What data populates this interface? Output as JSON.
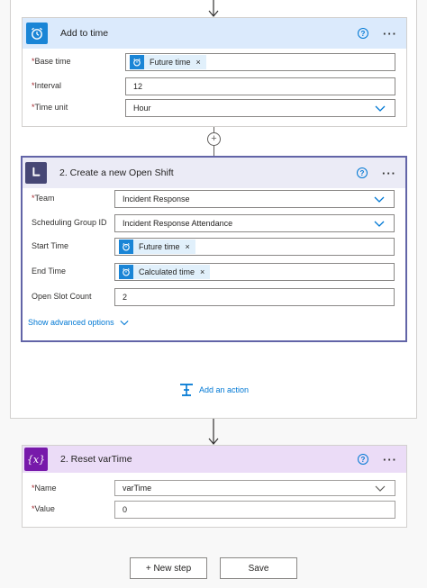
{
  "add_to_time": {
    "title": "Add to time",
    "header_color": "#dbeafc",
    "icon": "alarm-clock-icon",
    "fields": {
      "base_time_label": "Base time",
      "base_time_token": "Future time",
      "interval_label": "Interval",
      "interval_value": "12",
      "time_unit_label": "Time unit",
      "time_unit_value": "Hour"
    }
  },
  "open_shift": {
    "title": "2. Create a new Open Shift",
    "header_color": "#ebebf6",
    "icon": "teams-shifts-icon",
    "fields": {
      "team_label": "Team",
      "team_value": "Incident Response",
      "group_label": "Scheduling Group ID",
      "group_value": "Incident Response Attendance",
      "start_label": "Start Time",
      "start_token": "Future time",
      "end_label": "End Time",
      "end_token": "Calculated time",
      "slots_label": "Open Slot Count",
      "slots_value": "2"
    },
    "advanced_link": "Show advanced options"
  },
  "add_action": "Add an action",
  "reset_var": {
    "title": "2. Reset varTime",
    "header_color": "#ebdcf7",
    "icon": "variable-icon",
    "icon_text": "{x}",
    "fields": {
      "name_label": "Name",
      "name_value": "varTime",
      "value_label": "Value",
      "value_value": "0"
    }
  },
  "footer": {
    "new_step": "+ New step",
    "save": "Save"
  },
  "colors": {
    "accent": "#0078d4",
    "required": "#a4262c",
    "selected_border": "#6264a7",
    "variable_purple": "#7719aa"
  }
}
